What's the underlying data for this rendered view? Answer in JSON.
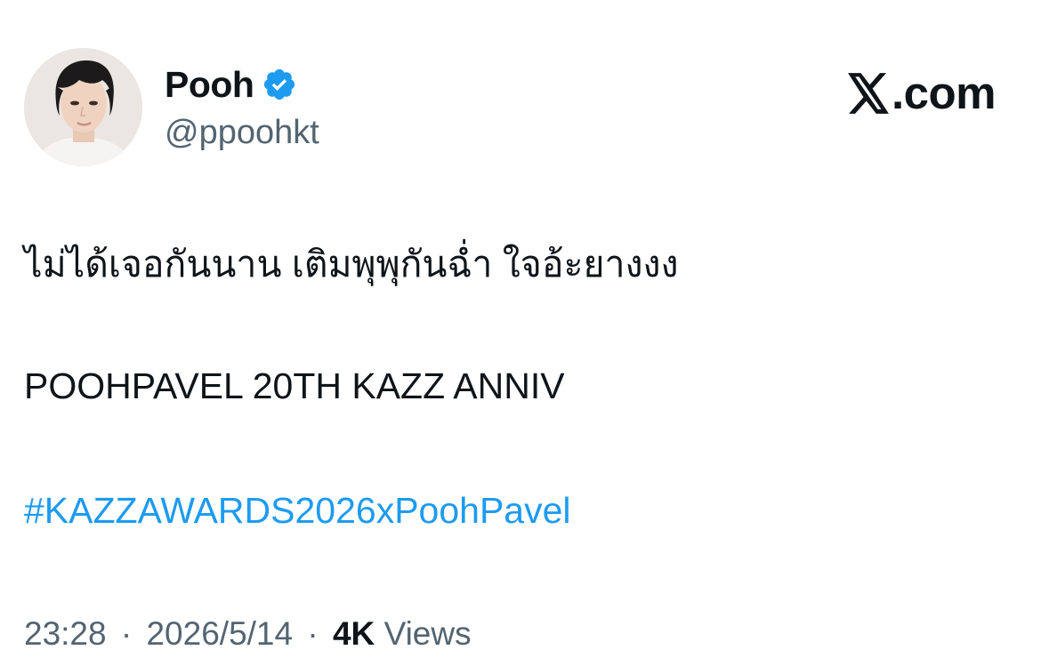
{
  "author": {
    "display_name": "Pooh",
    "handle": "@ppoohkt",
    "verified": true,
    "verified_icon": "verified-badge-icon",
    "avatar_icon": "profile-photo"
  },
  "brand": {
    "text": ".com",
    "icon": "x-logo-icon"
  },
  "tweet": {
    "line1": "ไม่ได้เจอกันนาน เติมพุพุกันฉ่ำ ใจอ้ะยางงง",
    "line2": "POOHPAVEL 20TH KAZZ ANNIV",
    "hashtag": "#KAZZAWARDS2026xPoohPavel"
  },
  "meta": {
    "time": "23:28",
    "separator": "·",
    "date": "2026/5/14",
    "views_count": "4K",
    "views_label": "Views"
  },
  "colors": {
    "text": "#0f1419",
    "secondary": "#536471",
    "link": "#1d9bf0",
    "verified": "#1d9bf0"
  }
}
